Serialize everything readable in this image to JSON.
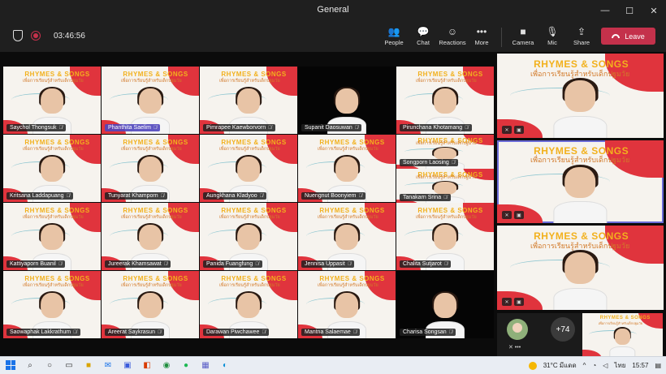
{
  "window": {
    "title": "General",
    "controls": [
      "—",
      "☐",
      "✕"
    ]
  },
  "toolbar": {
    "timer": "03:46:56",
    "buttons": [
      {
        "key": "people",
        "label": "People",
        "icon": "people-icon",
        "glyph": "👥"
      },
      {
        "key": "chat",
        "label": "Chat",
        "icon": "chat-icon",
        "glyph": "💬"
      },
      {
        "key": "reactions",
        "label": "Reactions",
        "icon": "reactions-icon",
        "glyph": "☺"
      },
      {
        "key": "more",
        "label": "More",
        "icon": "more-icon",
        "glyph": "•••"
      },
      {
        "key": "camera",
        "label": "Camera",
        "icon": "camera-icon",
        "glyph": "■"
      },
      {
        "key": "mic",
        "label": "Mic",
        "icon": "mic-icon",
        "glyph": "🎙"
      },
      {
        "key": "share",
        "label": "Share",
        "icon": "share-icon",
        "glyph": "⇪"
      }
    ],
    "leave_label": "Leave",
    "leave_color": "#c4314b"
  },
  "slide": {
    "brand": "RHYMES & SONGS",
    "subtitle": "เพื่อการเรียนรู้สำหรับเด็กปฐมวัย"
  },
  "participants": [
    {
      "name": "Saychol Thongsuk"
    },
    {
      "name": "Phanthita Saelim",
      "active": true
    },
    {
      "name": "Pimrapee Kaewborvorn"
    },
    {
      "name": "Supanit Daosuwan"
    },
    {
      "name": "Pirunchana Khotamang"
    },
    {
      "name": "Kritsana Laddapuang"
    },
    {
      "name": "Tunyarat Khamporn"
    },
    {
      "name": "Aungkhana Kladyoo"
    },
    {
      "name": "Nuengnut Boonyiem"
    },
    {
      "name": "Songporn Laosing"
    },
    {
      "name": "Tanakarn Srina"
    },
    {
      "name": "Kattiyaporn Buanil"
    },
    {
      "name": "Jureerak Khamsawat"
    },
    {
      "name": "Panida Fuangfung"
    },
    {
      "name": "Jennisa Uppasit"
    },
    {
      "name": "Chalita Sutjarot"
    },
    {
      "name": "Saowaphak Lakkrathum"
    },
    {
      "name": "Areerat Saykrasun"
    },
    {
      "name": "Darawan Piwchawee"
    },
    {
      "name": "Mantna Salaemae"
    },
    {
      "name": "Charisa Songsan"
    }
  ],
  "overflow": {
    "count_label": "+74"
  },
  "taskbar": {
    "weather": "31°C มีแดด",
    "lang": "ไทย",
    "clock": "15:57",
    "accent": "#1a73e8"
  }
}
